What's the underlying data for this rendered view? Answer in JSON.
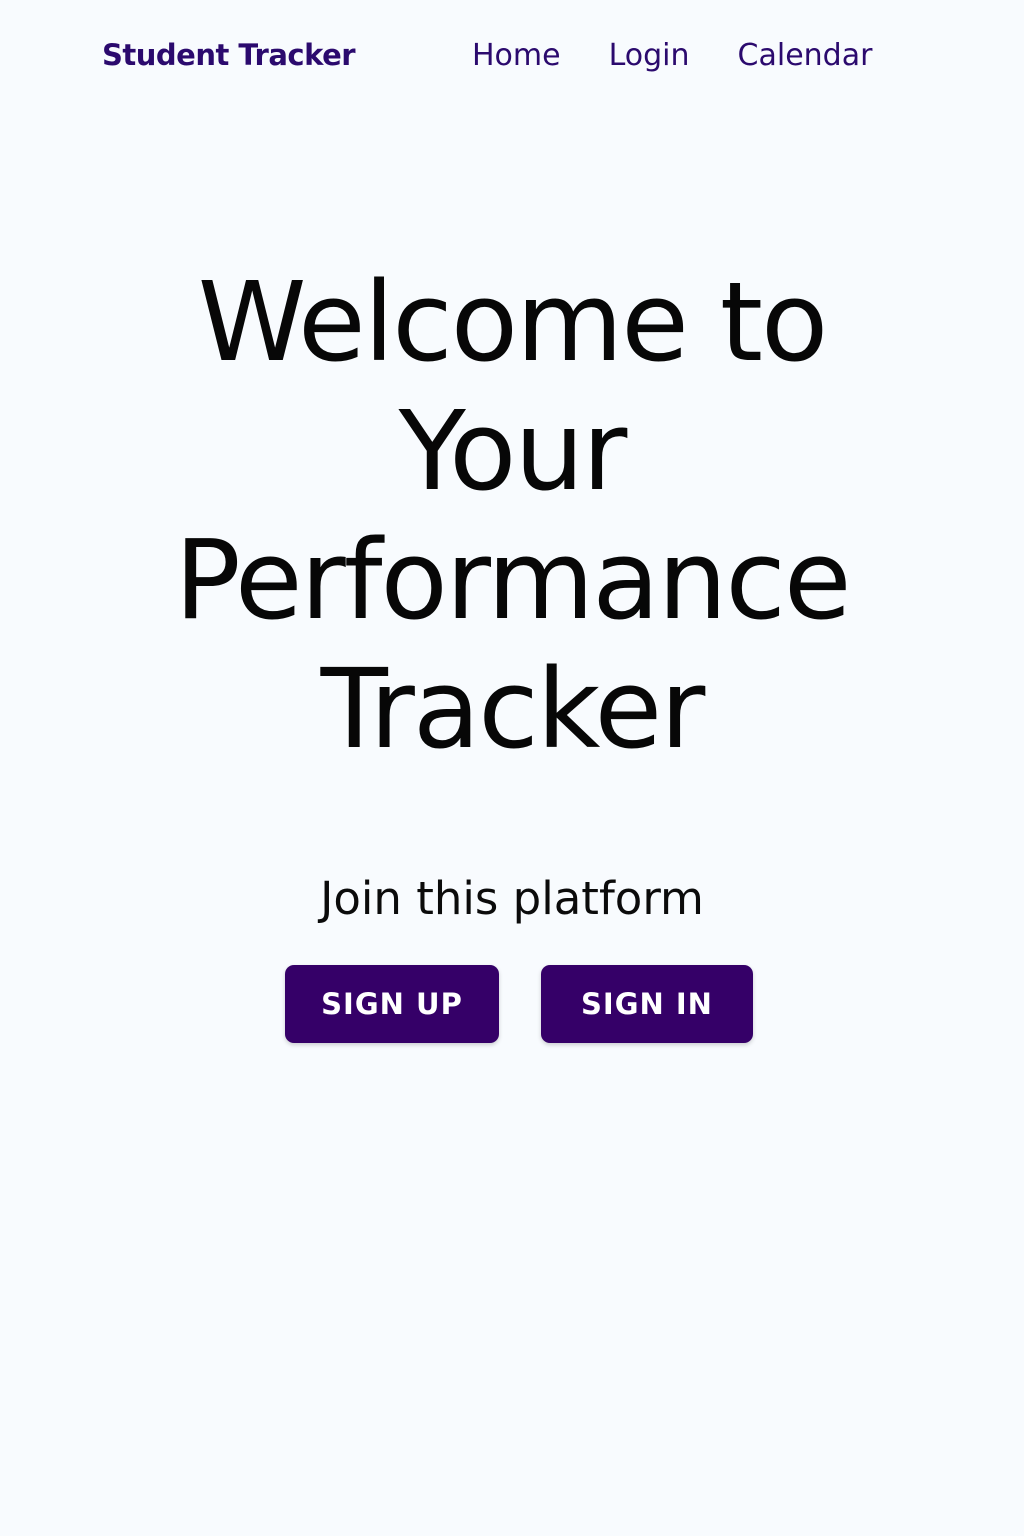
{
  "navbar": {
    "brand": "Student Tracker",
    "links": [
      "Home",
      "Login",
      "Calendar"
    ]
  },
  "hero": {
    "title": "Welcome to Your Performance Tracker",
    "subtitle": "Join this platform"
  },
  "actions": {
    "sign_up": "SIGN UP",
    "sign_in": "SIGN IN"
  },
  "colors": {
    "background": "#f8fbfe",
    "primary": "#350068",
    "nav_text": "#2b0a6e",
    "heading": "#070707"
  }
}
